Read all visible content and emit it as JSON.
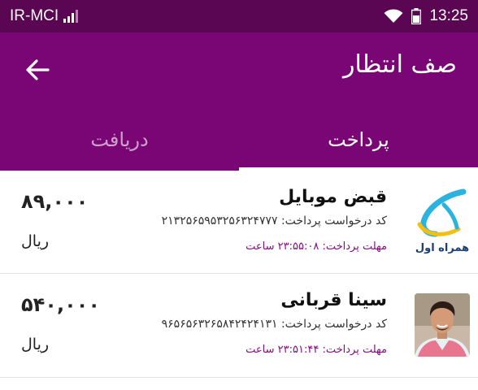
{
  "status_bar": {
    "carrier": "IR-MCI",
    "time": "13:25",
    "icons": [
      "cellular-signal-icon",
      "wifi-icon",
      "battery-icon"
    ]
  },
  "header": {
    "title": "صف انتظار",
    "back_icon": "arrow-left-icon"
  },
  "tabs": [
    {
      "label": "پرداخت",
      "active": true
    },
    {
      "label": "دریافت",
      "active": false
    }
  ],
  "colors": {
    "status_bar": "#5a0652",
    "app_bar": "#7a0676",
    "deadline_text": "#8a0a82",
    "divider": "#e2e2e2"
  },
  "requests": [
    {
      "title": "قبض موبایل",
      "code": "کد درخواست پرداخت: ۲۱۳۲۵۶۵۹۵۳۲۵۶۳۲۴۷۷۷",
      "deadline": "مهلت پرداخت: ۲۳:۵۵:۰۸ ساعت",
      "amount": "۸۹,۰۰۰",
      "currency": "ریال",
      "logo": "hamrah-aval-logo",
      "logo_text": "همراه اول"
    },
    {
      "title": "سینا قربانی",
      "code": "کد درخواست پرداخت: ۹۶۵۶۵۶۳۲۶۵۸۴۲۴۲۴۱۳۱",
      "deadline": "مهلت پرداخت: ۲۳:۵۱:۴۴ ساعت",
      "amount": "۵۴۰,۰۰۰",
      "currency": "ریال",
      "logo": "user-photo"
    }
  ]
}
